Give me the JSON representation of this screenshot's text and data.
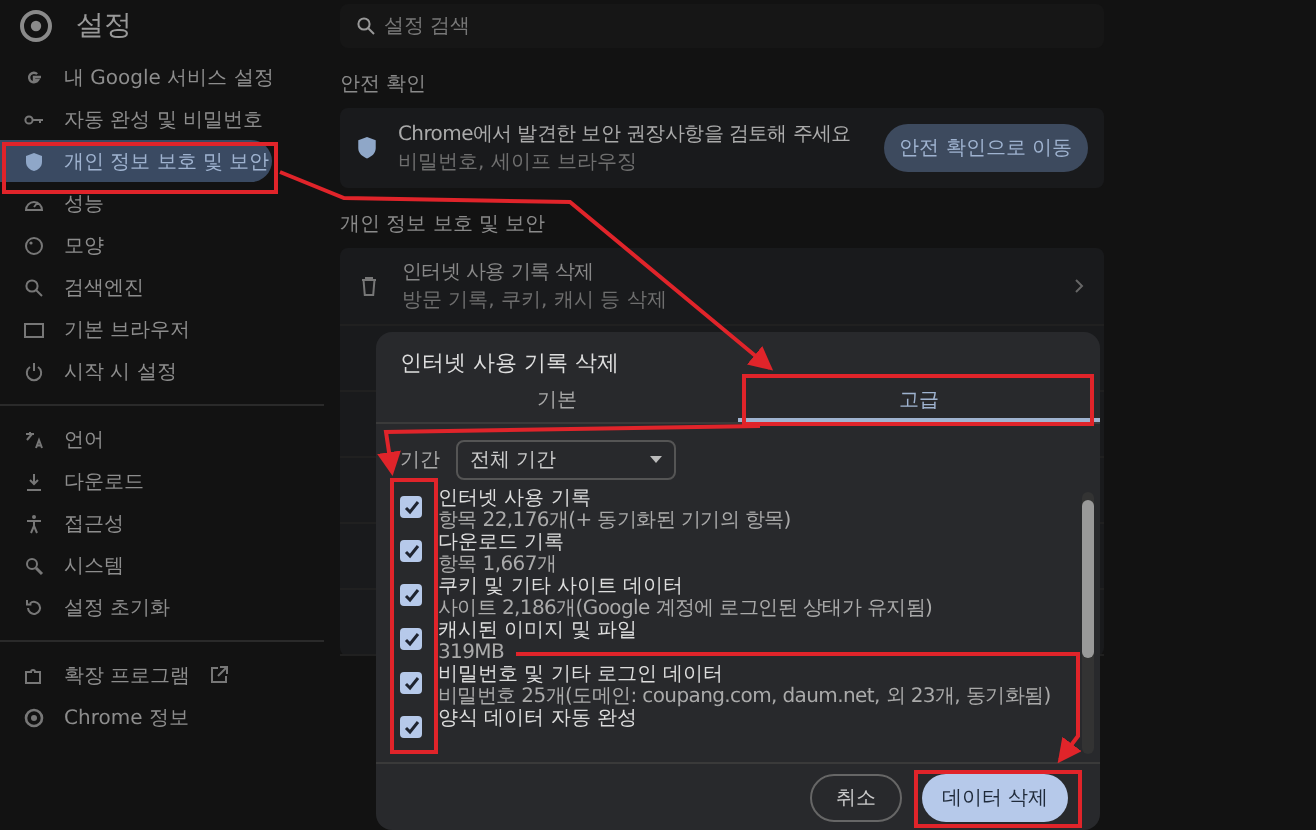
{
  "window": {
    "title": "설정"
  },
  "search": {
    "placeholder": "설정 검색"
  },
  "sidebar": {
    "sections": [
      {
        "items": [
          {
            "label": "내 Google 서비스 설정",
            "selected": false
          },
          {
            "label": "자동 완성 및 비밀번호",
            "selected": false
          },
          {
            "label": "개인 정보 보호 및 보안",
            "selected": true
          },
          {
            "label": "성능",
            "selected": false
          },
          {
            "label": "모양",
            "selected": false
          },
          {
            "label": "검색엔진",
            "selected": false
          },
          {
            "label": "기본 브라우저",
            "selected": false
          },
          {
            "label": "시작 시 설정",
            "selected": false
          }
        ]
      },
      {
        "items": [
          {
            "label": "언어",
            "selected": false
          },
          {
            "label": "다운로드",
            "selected": false
          },
          {
            "label": "접근성",
            "selected": false
          },
          {
            "label": "시스템",
            "selected": false
          },
          {
            "label": "설정 초기화",
            "selected": false
          }
        ]
      },
      {
        "items": [
          {
            "label": "확장 프로그램",
            "selected": false,
            "external": true
          },
          {
            "label": "Chrome 정보",
            "selected": false,
            "external": false
          }
        ]
      }
    ]
  },
  "safety_check": {
    "heading": "안전 확인",
    "title": "Chrome에서 발견한 보안 권장사항을 검토해 주세요",
    "subtitle": "비밀번호, 세이프 브라우징",
    "button": "안전 확인으로 이동"
  },
  "privacy": {
    "heading": "개인 정보 보호 및 보안",
    "rows": [
      {
        "title": "인터넷 사용 기록 삭제",
        "subtitle": "방문 기록, 쿠키, 캐시 등 삭제"
      }
    ]
  },
  "dialog": {
    "title": "인터넷 사용 기록 삭제",
    "tabs": [
      {
        "label": "기본",
        "selected": false
      },
      {
        "label": "고급",
        "selected": true
      }
    ],
    "period": {
      "label": "기간",
      "value": "전체 기간"
    },
    "items": [
      {
        "title": "인터넷 사용 기록",
        "subtitle": "항목 22,176개(+ 동기화된 기기의 항목)",
        "checked": true
      },
      {
        "title": "다운로드 기록",
        "subtitle": "항목 1,667개",
        "checked": true
      },
      {
        "title": "쿠키 및 기타 사이트 데이터",
        "subtitle": "사이트 2,186개(Google 계정에 로그인된 상태가 유지됨)",
        "checked": true
      },
      {
        "title": "캐시된 이미지 및 파일",
        "subtitle": "319MB",
        "checked": true
      },
      {
        "title": "비밀번호 및 기타 로그인 데이터",
        "subtitle": "비밀번호 25개(도메인: coupang.com, daum.net, 외 23개, 동기화됨)",
        "checked": true
      },
      {
        "title": "양식 데이터 자동 완성",
        "checked": true
      }
    ],
    "cancel": "취소",
    "confirm": "데이터 삭제"
  }
}
